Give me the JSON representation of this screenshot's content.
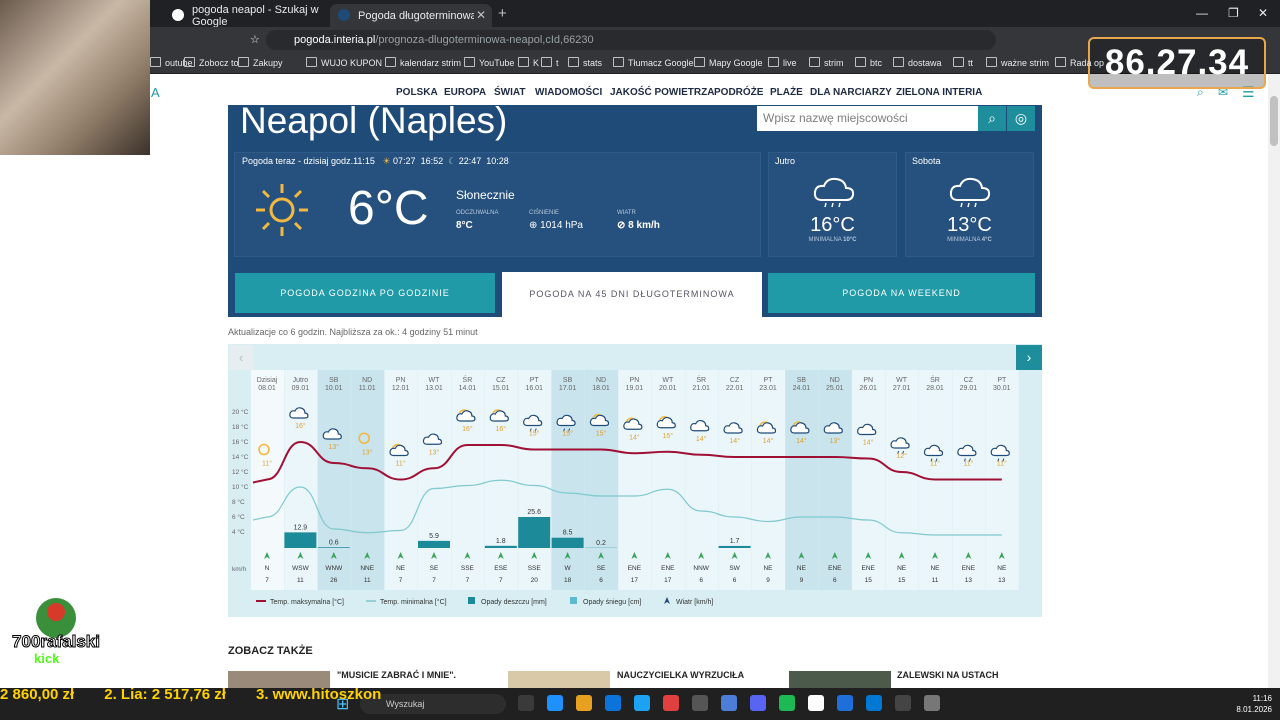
{
  "browser": {
    "tabs": [
      {
        "title": "pogoda neapol - Szukaj w Google"
      },
      {
        "title": "Pogoda długoterminowa Neapol"
      }
    ],
    "url_host": "pogoda.interia.pl",
    "url_path": "/prognoza-dlugoterminowa-neapol,cId,66230"
  },
  "bookmarks": [
    "outube",
    "Zobocz to",
    "Zakupy",
    "WUJO KUPON",
    "kalendarz strim",
    "YouTube",
    "K",
    "t",
    "stats",
    "Tłumacz Google",
    "Mapy Google",
    "live",
    "strim",
    "btc",
    "dostawa",
    "tt",
    "ważne strim",
    "Rada op"
  ],
  "overlay": {
    "counter": "86.27.34",
    "ticker": [
      "2 860,00 zł",
      "2. Lia: 2 517,76 zł",
      "3. www.hitoszkon"
    ],
    "logo_text": "700rafalski",
    "logo_sub": "kick"
  },
  "site": {
    "nav": [
      "POLSKA",
      "EUROPA",
      "ŚWIAT",
      "WIADOMOŚCI",
      "JAKOŚĆ POWIETRZA",
      "PODRÓŻE",
      "PLAŻE",
      "DLA NARCIARZY",
      "ZIELONA INTERIA"
    ]
  },
  "hero": {
    "city": "Neapol (Naples)",
    "search_placeholder": "Wpisz nazwę miejscowości",
    "now_header": "Pogoda teraz - dzisiaj godz.11:15",
    "sunrise": "07:27",
    "sunset": "16:52",
    "moonrise": "22:47",
    "moon_hours": "10:28",
    "temp": "6°C",
    "desc": "Słonecznie",
    "feels_label": "ODCZUWALNA",
    "feels": "8°C",
    "pressure_label": "CIŚNIENIE",
    "pressure": "1014 hPa",
    "wind_label": "WIATR",
    "wind": "8 km/h",
    "tomorrow": {
      "label": "Jutro",
      "temp": "16°C",
      "min_label": "MINIMALNA",
      "min": "10°C"
    },
    "saturday": {
      "label": "Sobota",
      "temp": "13°C",
      "min_label": "MINIMALNA",
      "min": "4°C"
    }
  },
  "tabs": [
    "POGODA GODZINA PO GODZINIE",
    "POGODA NA 45 DNI DŁUGOTERMINOWA",
    "POGODA NA WEEKEND"
  ],
  "update_note": "Aktualizacje co 6 godzin. Najbliższa za ok.: 4 godziny 51 minut",
  "see_also": "ZOBACZ TAKŻE",
  "articles": [
    "\"MUSICIE ZABRAĆ I MNIE\".",
    "NAUCZYCIELKA WYRZUCIŁA",
    "ZALEWSKI NA USTACH"
  ],
  "taskbar": {
    "search": "Wyszukaj",
    "time": "11:16",
    "date": "8.01.2026"
  },
  "chart_data": {
    "type": "line",
    "days": [
      "Dzisiaj",
      "Jutro",
      "SB",
      "ND",
      "PN",
      "WT",
      "ŚR",
      "CZ",
      "PT",
      "SB",
      "ND",
      "PN",
      "WT",
      "ŚR",
      "CZ",
      "PT",
      "SB",
      "ND",
      "PN",
      "WT",
      "ŚR",
      "CZ",
      "PT"
    ],
    "dates": [
      "08.01",
      "09.01",
      "10.01",
      "11.01",
      "12.01",
      "13.01",
      "14.01",
      "15.01",
      "16.01",
      "17.01",
      "18.01",
      "19.01",
      "20.01",
      "21.01",
      "22.01",
      "23.01",
      "24.01",
      "25.01",
      "26.01",
      "27.01",
      "28.01",
      "29.01",
      "30.01"
    ],
    "icon_temps": [
      "11°",
      "16°",
      "13°",
      "13°",
      "11°",
      "13°",
      "16°",
      "16°",
      "15°",
      "15°",
      "15°",
      "14°",
      "15°",
      "14°",
      "14°",
      "14°",
      "14°",
      "13°",
      "14°",
      "12°",
      "11°",
      "11°",
      "11°"
    ],
    "icons": [
      "sun",
      "cloud",
      "cloud",
      "sun",
      "sun-cloud",
      "cloud",
      "sun-cloud",
      "sun-cloud",
      "rain",
      "rain",
      "sun-cloud",
      "sun-cloud",
      "sun-cloud",
      "cloud",
      "cloud",
      "sun-cloud",
      "sun-cloud",
      "cloud",
      "cloud",
      "rain",
      "rain",
      "rain",
      "rain"
    ],
    "y_ticks": [
      "20 °C",
      "18 °C",
      "16 °C",
      "14 °C",
      "12 °C",
      "10 °C",
      "8 °C",
      "6 °C",
      "4 °C"
    ],
    "ylim": [
      4,
      20
    ],
    "series": [
      {
        "name": "Temp. maksymalna [°C]",
        "color": "#a01035",
        "values": [
          11,
          16,
          13.2,
          12.5,
          11,
          12.5,
          15.6,
          15.6,
          15,
          15,
          15,
          14.5,
          14.7,
          14.3,
          14,
          14,
          14,
          14,
          13.8,
          12,
          11,
          11,
          11
        ]
      },
      {
        "name": "Temp. minimalna [°C]",
        "color": "#7fc9cf",
        "values": [
          6,
          10,
          4.4,
          3.9,
          4.2,
          9.8,
          10.2,
          10.9,
          10.2,
          9.2,
          8.8,
          8.8,
          9.7,
          6.8,
          6,
          5.4,
          6,
          6,
          5.6,
          3.9,
          3.6,
          3.6,
          3.6
        ]
      }
    ],
    "rain_label": "Opady deszczu [mm]",
    "rain": [
      0,
      12.9,
      0.6,
      0,
      0,
      5.9,
      0,
      1.8,
      25.6,
      8.5,
      0.2,
      0,
      0,
      0,
      1.7,
      0,
      0,
      0,
      0,
      0,
      0,
      0,
      0
    ],
    "snow_label": "Opady śniegu [cm]",
    "wind_label": "Wiatr [km/h]",
    "wind_unit": "km/h",
    "wind_dir": [
      "N",
      "WSW",
      "WNW",
      "NNE",
      "NE",
      "SE",
      "SSE",
      "ESE",
      "SSE",
      "W",
      "SE",
      "ENE",
      "ENE",
      "NNW",
      "SW",
      "NE",
      "NE",
      "ENE",
      "ENE",
      "NE",
      "NE",
      "ENE",
      "NE"
    ],
    "wind_speed": [
      "7",
      "11",
      "26",
      "11",
      "7",
      "7",
      "7",
      "7",
      "20",
      "18",
      "6",
      "17",
      "17",
      "6",
      "6",
      "9",
      "9",
      "6",
      "15",
      "15",
      "11",
      "13",
      "13"
    ]
  }
}
